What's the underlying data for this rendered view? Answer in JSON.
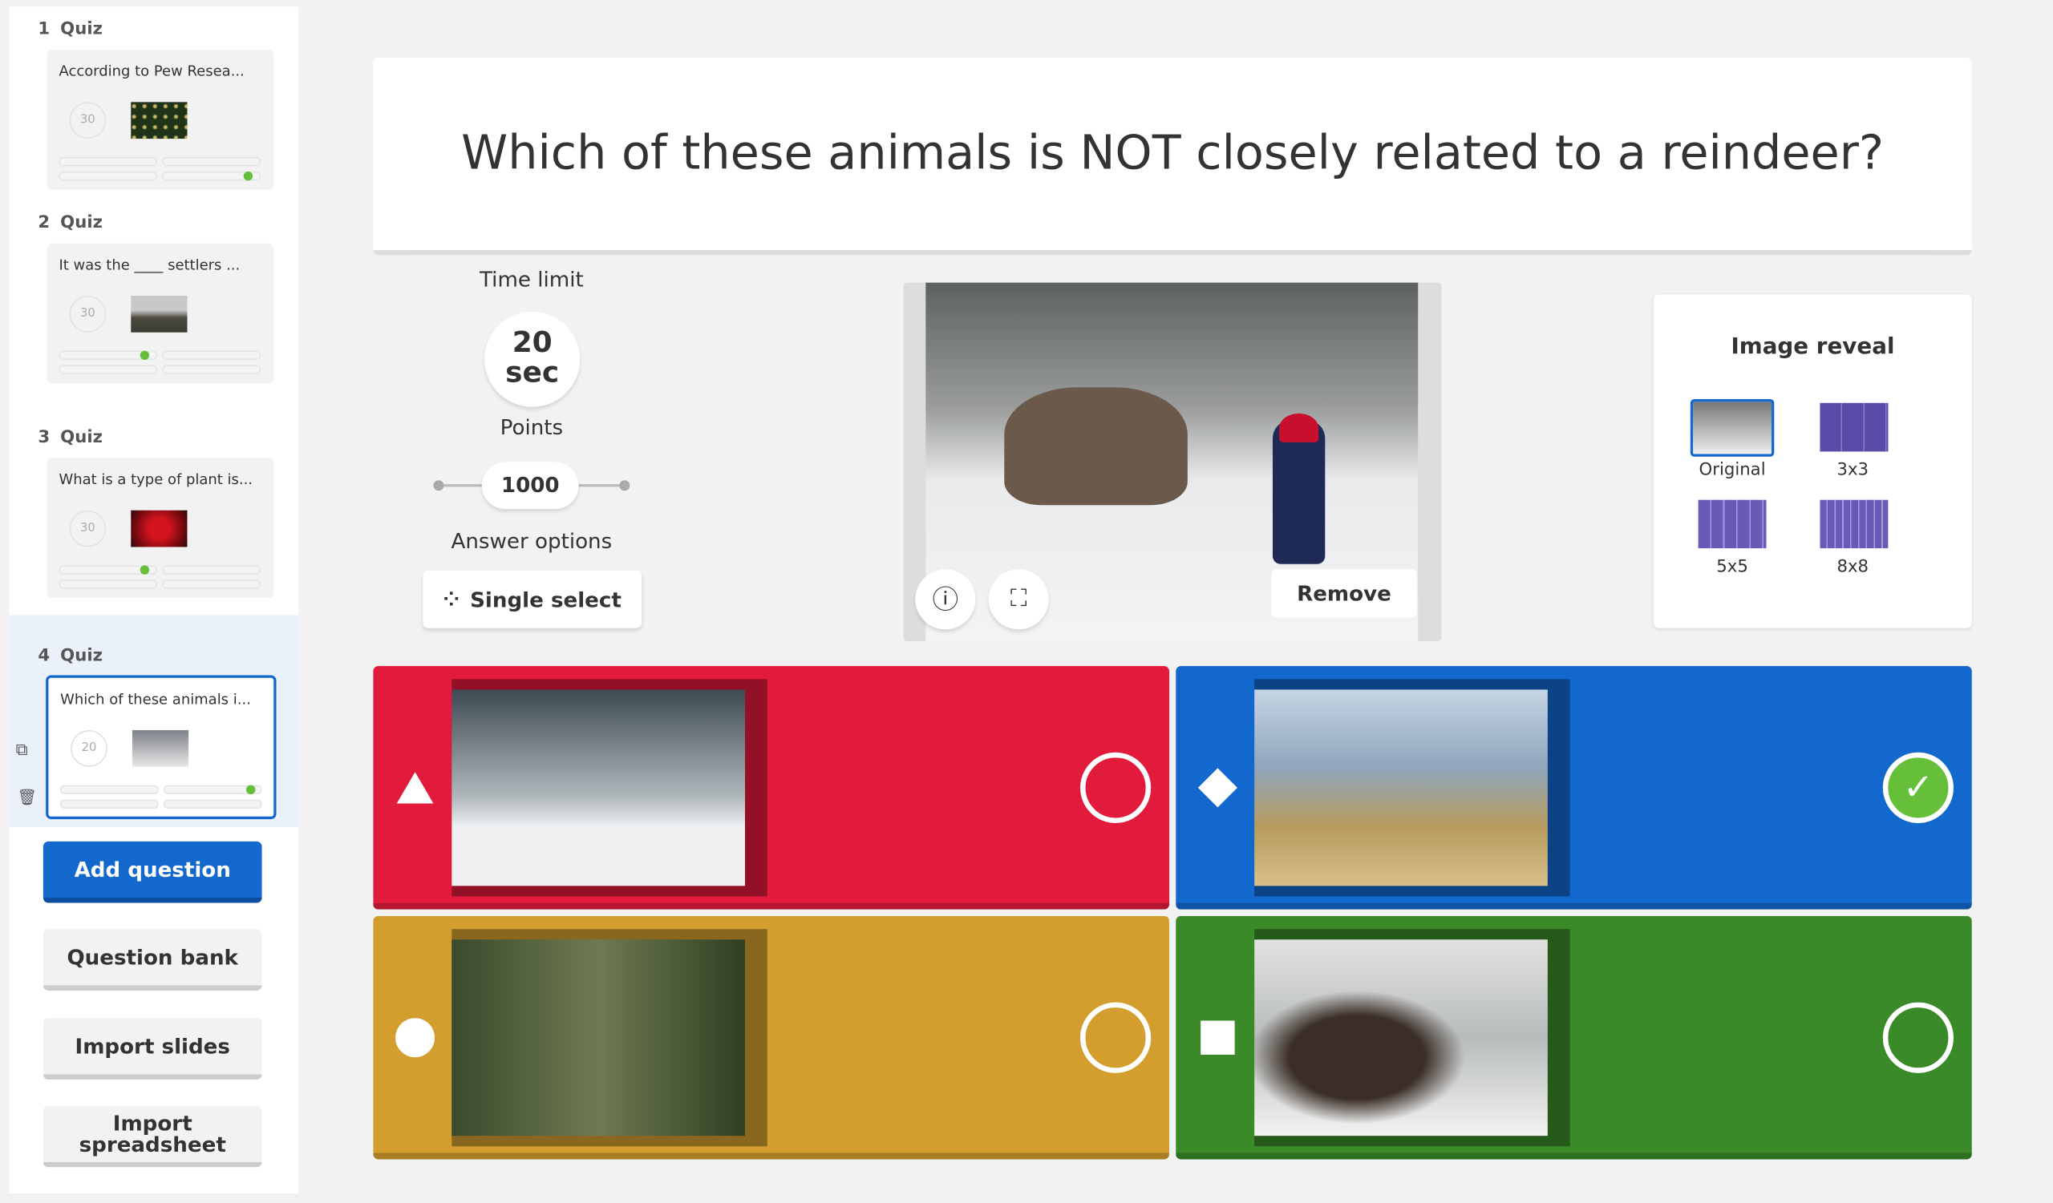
{
  "sidebar": {
    "slides": [
      {
        "number": "1",
        "type": "Quiz",
        "question": "According to Pew Resea...",
        "time": "30",
        "correct_index": 3
      },
      {
        "number": "2",
        "type": "Quiz",
        "question": "It was the ____ settlers ...",
        "time": "30",
        "correct_index": 0
      },
      {
        "number": "3",
        "type": "Quiz",
        "question": "What is a type of plant is...",
        "time": "30",
        "correct_index": 0
      },
      {
        "number": "4",
        "type": "Quiz",
        "question": "Which of these animals i...",
        "time": "20",
        "correct_index": 1
      }
    ],
    "buttons": {
      "add_question": "Add question",
      "question_bank": "Question bank",
      "import_slides": "Import slides",
      "import_spreadsheet_1": "Import",
      "import_spreadsheet_2": "spreadsheet"
    }
  },
  "question": {
    "title": "Which of these animals is NOT closely related to a reindeer?"
  },
  "settings": {
    "time_limit_label": "Time limit",
    "time_value": "20",
    "time_unit": "sec",
    "points_label": "Points",
    "points_value": "1000",
    "answer_options_label": "Answer options",
    "answer_type": "Single select"
  },
  "media": {
    "remove_label": "Remove",
    "image_alt": "Reindeer and child in snowy forest"
  },
  "image_reveal": {
    "title": "Image reveal",
    "options": [
      "Original",
      "3x3",
      "5x5",
      "8x8"
    ],
    "selected": "Original"
  },
  "answers": [
    {
      "shape": "triangle",
      "color": "#e21b3c",
      "image": "Red deer stag and doe in snow",
      "correct": false
    },
    {
      "shape": "diamond",
      "color": "#1368ce",
      "image": "Kudu antelope in grassland",
      "correct": true
    },
    {
      "shape": "circle",
      "color": "#d89e00",
      "image": "Elk in forest",
      "correct": false
    },
    {
      "shape": "square",
      "color": "#26890c",
      "image": "Moose in snowy forest",
      "correct": false
    }
  ],
  "colors": {
    "accent": "#1368ce",
    "correct": "#66bf39"
  }
}
